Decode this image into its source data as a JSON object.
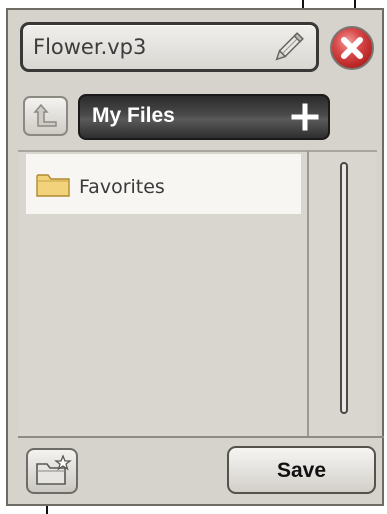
{
  "header": {
    "filename": "Flower.vp3",
    "edit_icon": "pencil-icon",
    "close_icon": "close-x-icon"
  },
  "path_bar": {
    "current_folder": "My Files",
    "up_icon": "folder-up-icon",
    "add_icon": "plus-icon"
  },
  "file_list": {
    "items": [
      {
        "label": "Favorites",
        "icon": "folder-icon"
      }
    ]
  },
  "footer": {
    "new_folder_icon": "new-folder-icon",
    "save_label": "Save"
  },
  "colors": {
    "panel_bg": "#d6d3cd",
    "path_bar_bg": "#3a3a3a",
    "close_red": "#c62a2a",
    "folder_yellow": "#f2d27a"
  }
}
